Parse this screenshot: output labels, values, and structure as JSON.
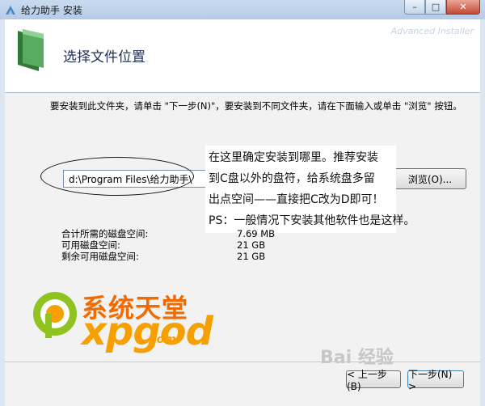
{
  "window": {
    "title": "给力助手 安装",
    "minimize_label": "–",
    "maximize_label": "□",
    "close_label": "✕"
  },
  "header": {
    "title": "选择文件位置",
    "brand": "Advanced Installer"
  },
  "instruction": "要安装到此文件夹，请单击 \"下一步(N)\"，要安装到不同文件夹，请在下面输入或单击 \"浏览\" 按钮。",
  "install_path": {
    "value": "d:\\Program Files\\给力助手\\"
  },
  "browse_label": "浏览(O)...",
  "annotation": {
    "lines": [
      "在这里确定安装到哪里。推荐安装",
      "到C盘以外的盘符，给系统盘多留",
      "出点空间——直接把C改为D即可！",
      "PS：一般情况下安装其他软件也是这样。"
    ]
  },
  "space": [
    {
      "label": "合计所需的磁盘空间:",
      "value": "7.69 MB"
    },
    {
      "label": "可用磁盘空间:",
      "value": "21 GB"
    },
    {
      "label": "剩余可用磁盘空间:",
      "value": "21 GB"
    }
  ],
  "logo": {
    "cn": "系统天堂",
    "en": "xpgod",
    "com": ".com"
  },
  "baidu_watermark": "Bai 经验",
  "buttons": {
    "back": "< 上一步(B)",
    "next": "下一步(N) >"
  }
}
